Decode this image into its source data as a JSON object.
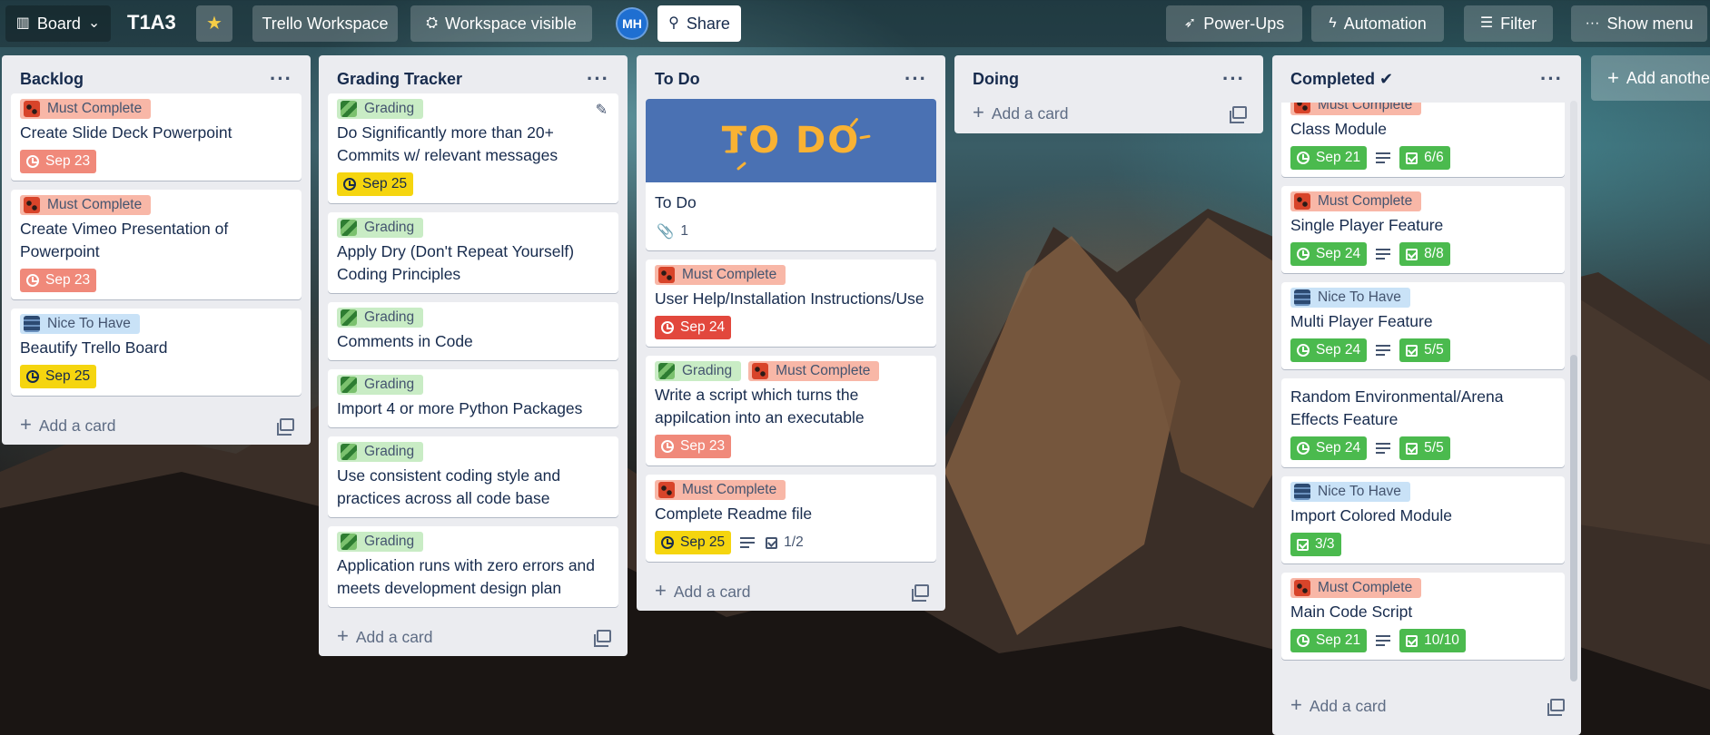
{
  "header": {
    "view_label": "Board",
    "board_title": "T1A3",
    "workspace_label": "Trello Workspace",
    "visibility_label": "Workspace visible",
    "avatar_initials": "MH",
    "share_label": "Share",
    "powerups_label": "Power-Ups",
    "automation_label": "Automation",
    "filter_label": "Filter",
    "menu_label": "Show menu"
  },
  "add_card_label": "Add a card",
  "add_list_label": "Add another list",
  "lists": [
    {
      "title": "Backlog",
      "cards": [
        {
          "label": "Must Complete",
          "title": "Create Slide Deck Powerpoint",
          "due": "Sep 23"
        },
        {
          "label": "Must Complete",
          "title": "Create Vimeo Presentation of Powerpoint",
          "due": "Sep 23"
        },
        {
          "label": "Nice To Have",
          "title": "Beautify Trello Board",
          "due": "Sep 25"
        }
      ]
    },
    {
      "title": "Grading Tracker",
      "cards": [
        {
          "label": "Grading",
          "title": "Do Significantly more than 20+ Commits w/ relevant messages",
          "due": "Sep 25"
        },
        {
          "label": "Grading",
          "title": "Apply Dry (Don't Repeat Yourself) Coding Principles"
        },
        {
          "label": "Grading",
          "title": "Comments in Code"
        },
        {
          "label": "Grading",
          "title": "Import 4 or more Python Packages"
        },
        {
          "label": "Grading",
          "title": "Use consistent coding style and practices across all code base"
        },
        {
          "label": "Grading",
          "title": "Application runs with zero errors and meets development design plan"
        }
      ]
    },
    {
      "title": "To Do",
      "cards": [
        {
          "cover_text": "TO DO",
          "title": "To Do",
          "attachments": "1"
        },
        {
          "label": "Must Complete",
          "title": "User Help/Installation Instructions/Use",
          "due": "Sep 24"
        },
        {
          "label": "Grading",
          "label2": "Must Complete",
          "title": "Write a script which turns the appilcation into an executable",
          "due": "Sep 23"
        },
        {
          "label": "Must Complete",
          "title": "Complete Readme file",
          "due": "Sep 25",
          "checklist": "1/2"
        }
      ]
    },
    {
      "title": "Doing",
      "cards": []
    },
    {
      "title": "Completed ✔",
      "cards": [
        {
          "label": "Must Complete",
          "title": "Class Module",
          "due": "Sep 21",
          "checklist": "6/6"
        },
        {
          "label": "Must Complete",
          "title": "Single Player Feature",
          "due": "Sep 24",
          "checklist": "8/8"
        },
        {
          "label": "Nice To Have",
          "title": "Multi Player Feature",
          "due": "Sep 24",
          "checklist": "5/5"
        },
        {
          "title": "Random Environmental/Arena Effects Feature",
          "due": "Sep 24",
          "checklist": "5/5"
        },
        {
          "label": "Nice To Have",
          "title": "Import Colored Module",
          "checklist": "3/3"
        },
        {
          "label": "Must Complete",
          "title": "Main Code Script",
          "due": "Sep 21",
          "checklist": "10/10"
        }
      ]
    }
  ],
  "colors": {
    "must_complete": "#f8b7a7",
    "grading": "#c9ecc5",
    "nice_to_have": "#c9e2f7",
    "due_overdue": "#f0897a",
    "due_soon": "#f5d50f",
    "due_red": "#e2483d",
    "complete": "#4bba4e"
  },
  "icons": [
    "board-icon",
    "chevron-down-icon",
    "star-icon",
    "people-icon",
    "add-person-icon",
    "rocket-icon",
    "lightning-icon",
    "filter-icon",
    "more-icon",
    "clock-icon",
    "checklist-icon",
    "description-icon",
    "attachment-icon",
    "template-icon",
    "pencil-icon",
    "plus-icon"
  ]
}
